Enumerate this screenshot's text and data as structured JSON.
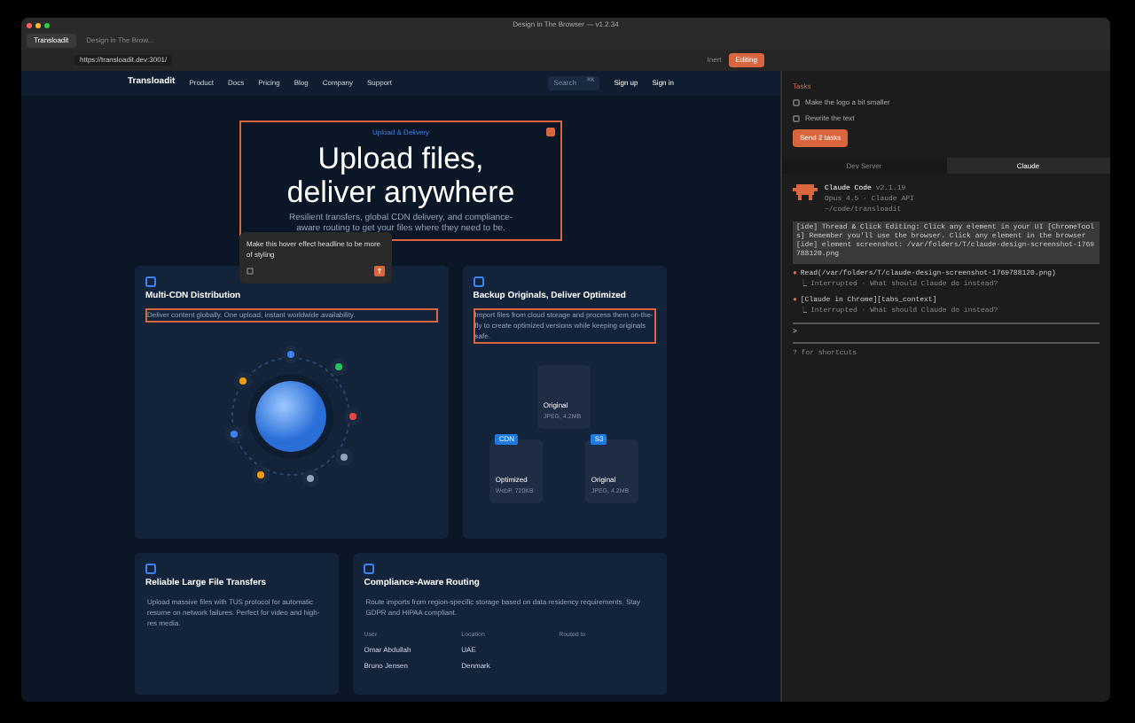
{
  "window": {
    "title": "Design in The Browser — v1.2.34"
  },
  "tabs": [
    {
      "label": "Transloadit",
      "selected": true
    },
    {
      "label": "Design in The Brow...",
      "selected": false
    }
  ],
  "address_bar": {
    "url": "https://transloadit.dev:3001/"
  },
  "toolbar": {
    "inert_label": "Inert",
    "editing_button": "Editing",
    "editing": true
  },
  "site_nav": {
    "brand": "Transloadit",
    "items": [
      "Product",
      "Docs",
      "Pricing",
      "Blog",
      "Company",
      "Support"
    ],
    "search": {
      "placeholder": "Search",
      "shortcut": "⌘K"
    },
    "sign_up": "Sign up",
    "sign_in": "Sign in"
  },
  "hero": {
    "eyebrow": "Upload & Delivery",
    "title_lines": [
      "Upload files,",
      "deliver anywhere"
    ],
    "subtitle": "Resilient transfers, global CDN delivery, and compliance-aware routing to get your files where they need to be."
  },
  "comment_popup": {
    "text": "Make this hover effect headline to be more of styling"
  },
  "features": [
    {
      "title": "Multi-CDN Distribution",
      "text": "Deliver content globally. One upload, instant worldwide availability.",
      "highlighted": true
    },
    {
      "title": "Backup Originals, Deliver Optimized",
      "text": "Import files from cloud storage and process them on-the-fly to create optimized versions while keeping originals safe.",
      "highlighted": true,
      "files": [
        {
          "name": "Original",
          "meta": "JPEG, 4.2MB"
        },
        {
          "name": "Optimized",
          "meta": "WebP, 720KB",
          "badge": "CDN"
        },
        {
          "name": "Original",
          "meta": "JPEG, 4.2MB",
          "badge": "S3"
        }
      ]
    },
    {
      "title": "Reliable Large File Transfers",
      "text": "Upload massive files with TUS protocol for automatic resume on network failures. Perfect for video and high-res media.",
      "highlighted": false
    },
    {
      "title": "Compliance-Aware Routing",
      "text": "Route imports from region-specific storage based on data residency requirements. Stay GDPR and HIPAA compliant.",
      "highlighted": false,
      "columns": [
        "User",
        "Location",
        "Routed to"
      ],
      "rows": [
        {
          "user": "Omar Abdullah",
          "location": "UAE"
        },
        {
          "user": "Bruno Jensen",
          "location": "Denmark"
        }
      ]
    }
  ],
  "tasks_panel": {
    "heading": "Tasks",
    "tasks": [
      {
        "label": "Make the logo a bit smaller",
        "checked": false
      },
      {
        "label": "Rewrite the text",
        "checked": false
      }
    ],
    "send_button": "Send 2 tasks"
  },
  "panel_tabs": [
    {
      "label": "Dev Server",
      "selected": false
    },
    {
      "label": "Claude",
      "selected": true
    }
  ],
  "terminal": {
    "app": "Claude Code",
    "version": "v2.1.19",
    "model": "Opus 4.5 · Claude API",
    "cwd": "~/code/transloadit",
    "prompt": "[ide] Thread & Click Editing: Click any element in your UI [ChromeTools] Remember you'll use the browser. Click any element in the browser [ide] element screenshot: /var/folders/T/claude-design-screenshot-1769788120.png",
    "call_marker": "●",
    "result_marker": "⎿",
    "entries": [
      {
        "call": "Read(/var/folders/T/claude-design-screenshot-1769788120.png)",
        "result": "Interrupted · What should Claude do instead?"
      },
      {
        "call": "[Claude in Chrome][tabs_context]",
        "result": "Interrupted · What should Claude do instead?"
      }
    ],
    "input_prompt": ">",
    "hint": "? for shortcuts"
  }
}
